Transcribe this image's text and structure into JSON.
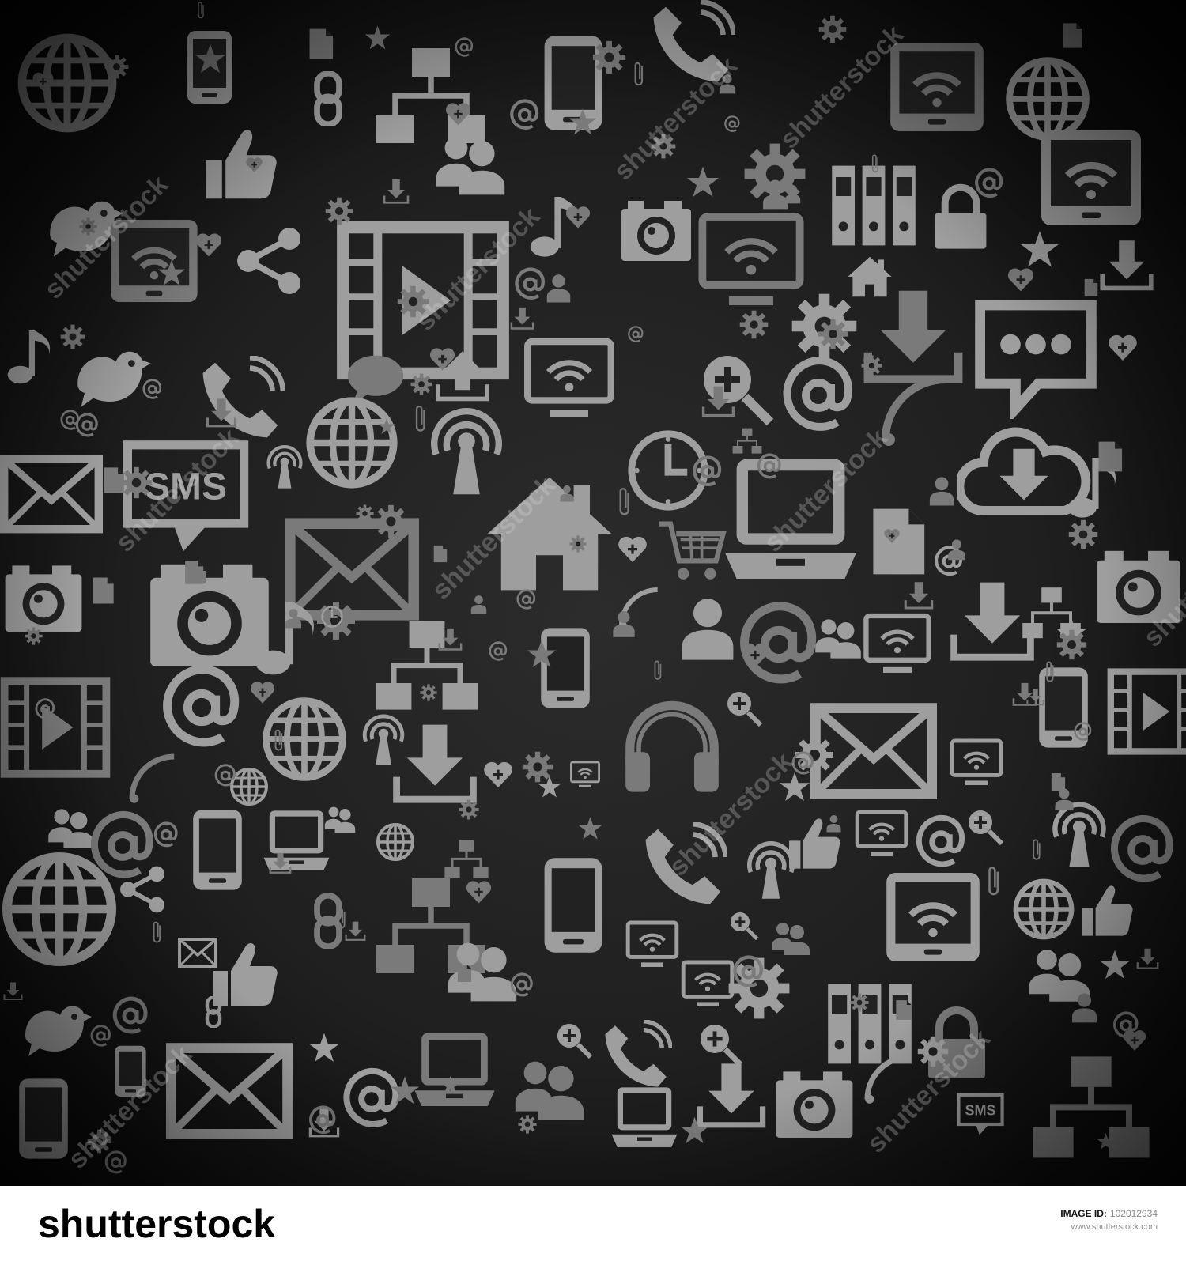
{
  "picture": {
    "subject": "seamless pattern of gray communication and media icons on a dark background",
    "icon_names": [
      "globe-icon",
      "smartphone-icon",
      "chain-link-icon",
      "thumbs-up-icon",
      "bird-icon",
      "tablet-wifi-icon",
      "share-icon",
      "film-play-icon",
      "music-note-icon",
      "camera-icon",
      "laptop-icon",
      "binders-icon",
      "lock-icon",
      "home-icon",
      "download-icon",
      "chat-bubble-icon",
      "phone-handset-icon",
      "envelope-icon",
      "clock-icon",
      "broadcast-tower-icon",
      "shopping-cart-icon",
      "heart-plus-icon",
      "users-icon",
      "at-sign-icon",
      "headphones-icon",
      "network-hierarchy-icon",
      "gear-icon",
      "magnifier-plus-icon",
      "star-icon",
      "sms-bubble-icon",
      "cloud-download-icon",
      "upload-icon",
      "paperclip-icon"
    ],
    "colors": {
      "background": "#252525",
      "vignette": "#050505",
      "icon": "#9e9e9e",
      "icon_dark": "#7a7a7a",
      "watermark": "#cfcfcf"
    },
    "sms_label": "SMS",
    "watermark_text": "shutterstock"
  },
  "footer": {
    "brand": "shutterstock",
    "image_id_label": "IMAGE ID:",
    "image_id_value": "102012934",
    "site": "www.shutterstock.com"
  }
}
